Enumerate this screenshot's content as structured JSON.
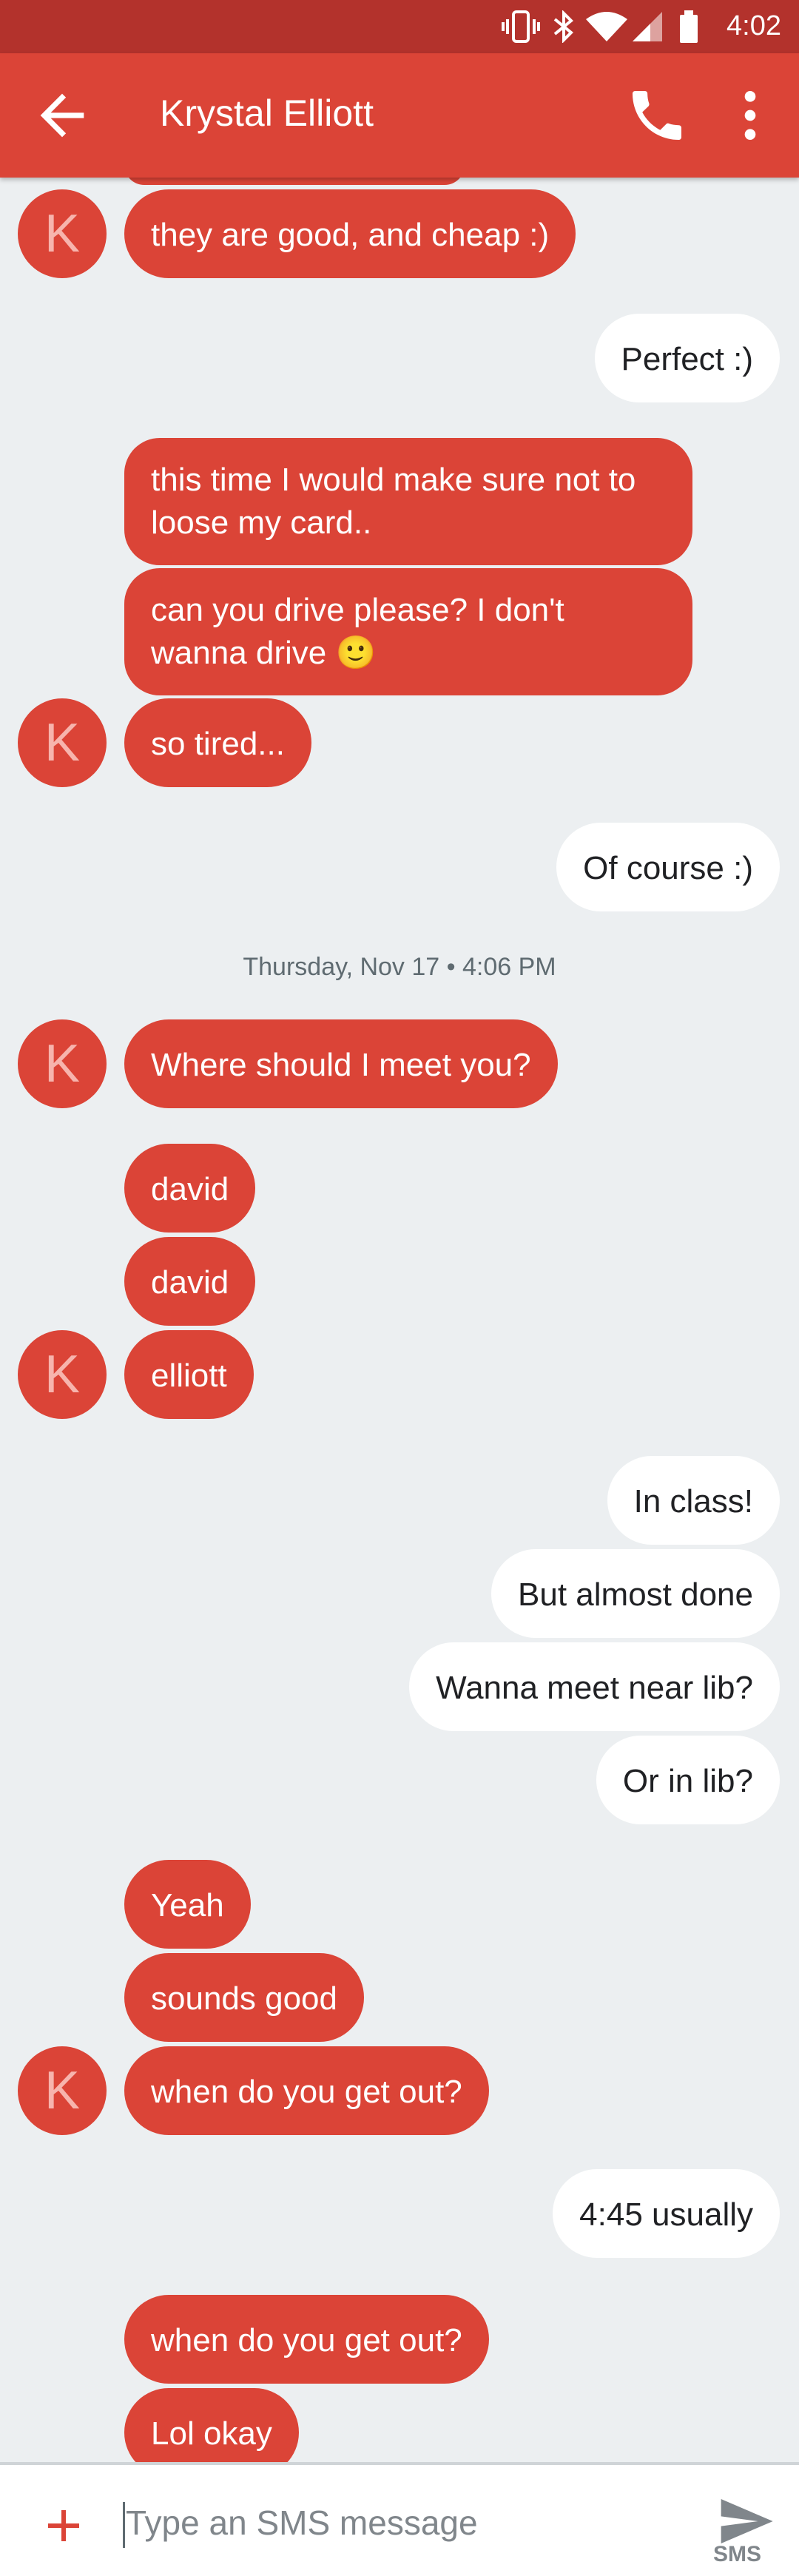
{
  "status_bar": {
    "time": "4:02"
  },
  "header": {
    "contact_name": "Krystal Elliott"
  },
  "contact_initial": "K",
  "messages": [
    {
      "text": "they are good, and cheap :)"
    },
    {
      "text": "Perfect :)"
    },
    {
      "text": "this time I would make sure not to loose my card.."
    },
    {
      "text": "can you drive please? I don't wanna drive 🙂"
    },
    {
      "text": "so tired..."
    },
    {
      "text": "Of course :)"
    },
    {
      "text": "Where should I meet you?"
    },
    {
      "text": "david"
    },
    {
      "text": "david"
    },
    {
      "text": "elliott"
    },
    {
      "text": "In class!"
    },
    {
      "text": "But almost done"
    },
    {
      "text": "Wanna meet near lib?"
    },
    {
      "text": "Or in lib?"
    },
    {
      "text": "Yeah"
    },
    {
      "text": "sounds good"
    },
    {
      "text": "when do you get out?"
    },
    {
      "text": "4:45 usually"
    },
    {
      "text": "when do you get out?"
    },
    {
      "text": "Lol okay"
    }
  ],
  "timestamp_divider": "Thursday, Nov 17 • 4:06 PM",
  "composer": {
    "placeholder": "Type an SMS message",
    "send_label": "SMS"
  },
  "colors": {
    "accent": "#db4437",
    "status_bar": "#b3322c",
    "background": "#eceff1"
  },
  "icons": [
    "vibrate-icon",
    "bluetooth-icon",
    "wifi-icon",
    "cell-signal-icon",
    "battery-icon",
    "back-arrow-icon",
    "phone-icon",
    "more-vert-icon",
    "add-icon",
    "send-icon"
  ]
}
